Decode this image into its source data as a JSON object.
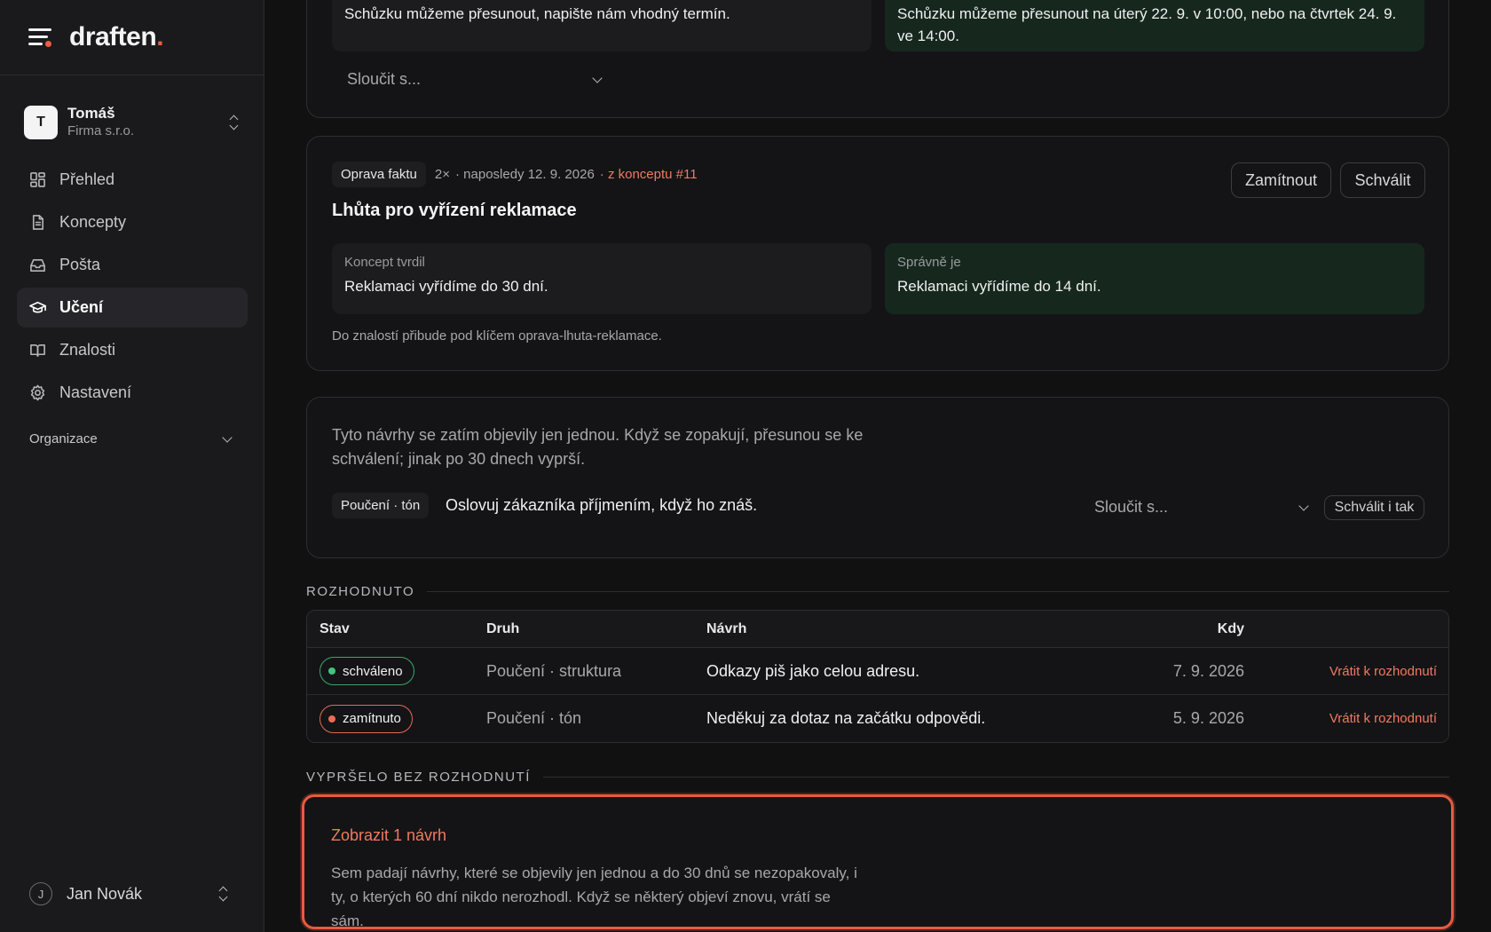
{
  "brand": {
    "name_main": "draften",
    "name_dot": "."
  },
  "account": {
    "initial": "T",
    "name": "Tomáš",
    "org": "Firma s.r.o."
  },
  "nav": [
    {
      "label": "Přehled",
      "icon": "dashboard-icon",
      "active": false
    },
    {
      "label": "Koncepty",
      "icon": "document-icon",
      "active": false
    },
    {
      "label": "Pošta",
      "icon": "inbox-icon",
      "active": false
    },
    {
      "label": "Učení",
      "icon": "graduation-cap-icon",
      "active": true
    },
    {
      "label": "Znalosti",
      "icon": "book-icon",
      "active": false
    },
    {
      "label": "Nastavení",
      "icon": "gear-icon",
      "active": false
    }
  ],
  "organization_label": "Organizace",
  "user": {
    "initial": "J",
    "name": "Jan Novák"
  },
  "top_card": {
    "left_text": "Schůzku můžeme přesunout, napište nám vhodný termín.",
    "right_text": "Schůzku můžeme přesunout na úterý 22. 9. v 10:00, nebo na čtvrtek 24. 9. ve 14:00.",
    "merge_label": "Sloučit s..."
  },
  "fact_card": {
    "chip": "Oprava faktu",
    "count": "2×",
    "last": "· naposledy 12. 9. 2026",
    "source": "· z konceptu #11",
    "reject_label": "Zamítnout",
    "approve_label": "Schválit",
    "title": "Lhůta pro vyřízení reklamace",
    "left_label": "Koncept tvrdil",
    "left_text": "Reklamaci vyřídíme do 30 dní.",
    "right_label": "Správně je",
    "right_text": "Reklamaci vyřídíme do 14 dní.",
    "note": "Do znalostí přibude pod klíčem oprava-lhuta-reklamace."
  },
  "pending_card": {
    "intro": "Tyto návrhy se zatím objevily jen jednou. Když se zopakují, přesunou se ke schválení; jinak po 30 dnech vyprší.",
    "chip": "Poučení · tón",
    "text": "Oslovuj zákazníka příjmením, když ho znáš.",
    "merge_label": "Sloučit s...",
    "approve_anyway_label": "Schválit i tak"
  },
  "decided": {
    "section_label": "ROZHODNUTO",
    "columns": {
      "status": "Stav",
      "kind": "Druh",
      "proposal": "Návrh",
      "when": "Kdy"
    },
    "rows": [
      {
        "status": "schváleno",
        "kind": "Poučení · struktura",
        "proposal": "Odkazy piš jako celou adresu.",
        "when": "7. 9. 2026",
        "action": "Vrátit k rozhodnutí"
      },
      {
        "status": "zamítnuto",
        "kind": "Poučení · tón",
        "proposal": "Neděkuj za dotaz na začátku odpovědi.",
        "when": "5. 9. 2026",
        "action": "Vrátit k rozhodnutí"
      }
    ]
  },
  "expired": {
    "section_label": "VYPRŠELO BEZ ROZHODNUTÍ",
    "show_label": "Zobrazit 1 návrh",
    "text": "Sem padají návrhy, které se objevily jen jednou a do 30 dnů se nezopakovaly, i ty, o kterých 60 dní nikdo nerozhodl. Když se některý objeví znovu, vrátí se sám."
  },
  "colors": {
    "accent": "#ee5b43",
    "approved": "#44c27e",
    "rejected": "#ef6a56",
    "correct_bg": "#16281e"
  }
}
